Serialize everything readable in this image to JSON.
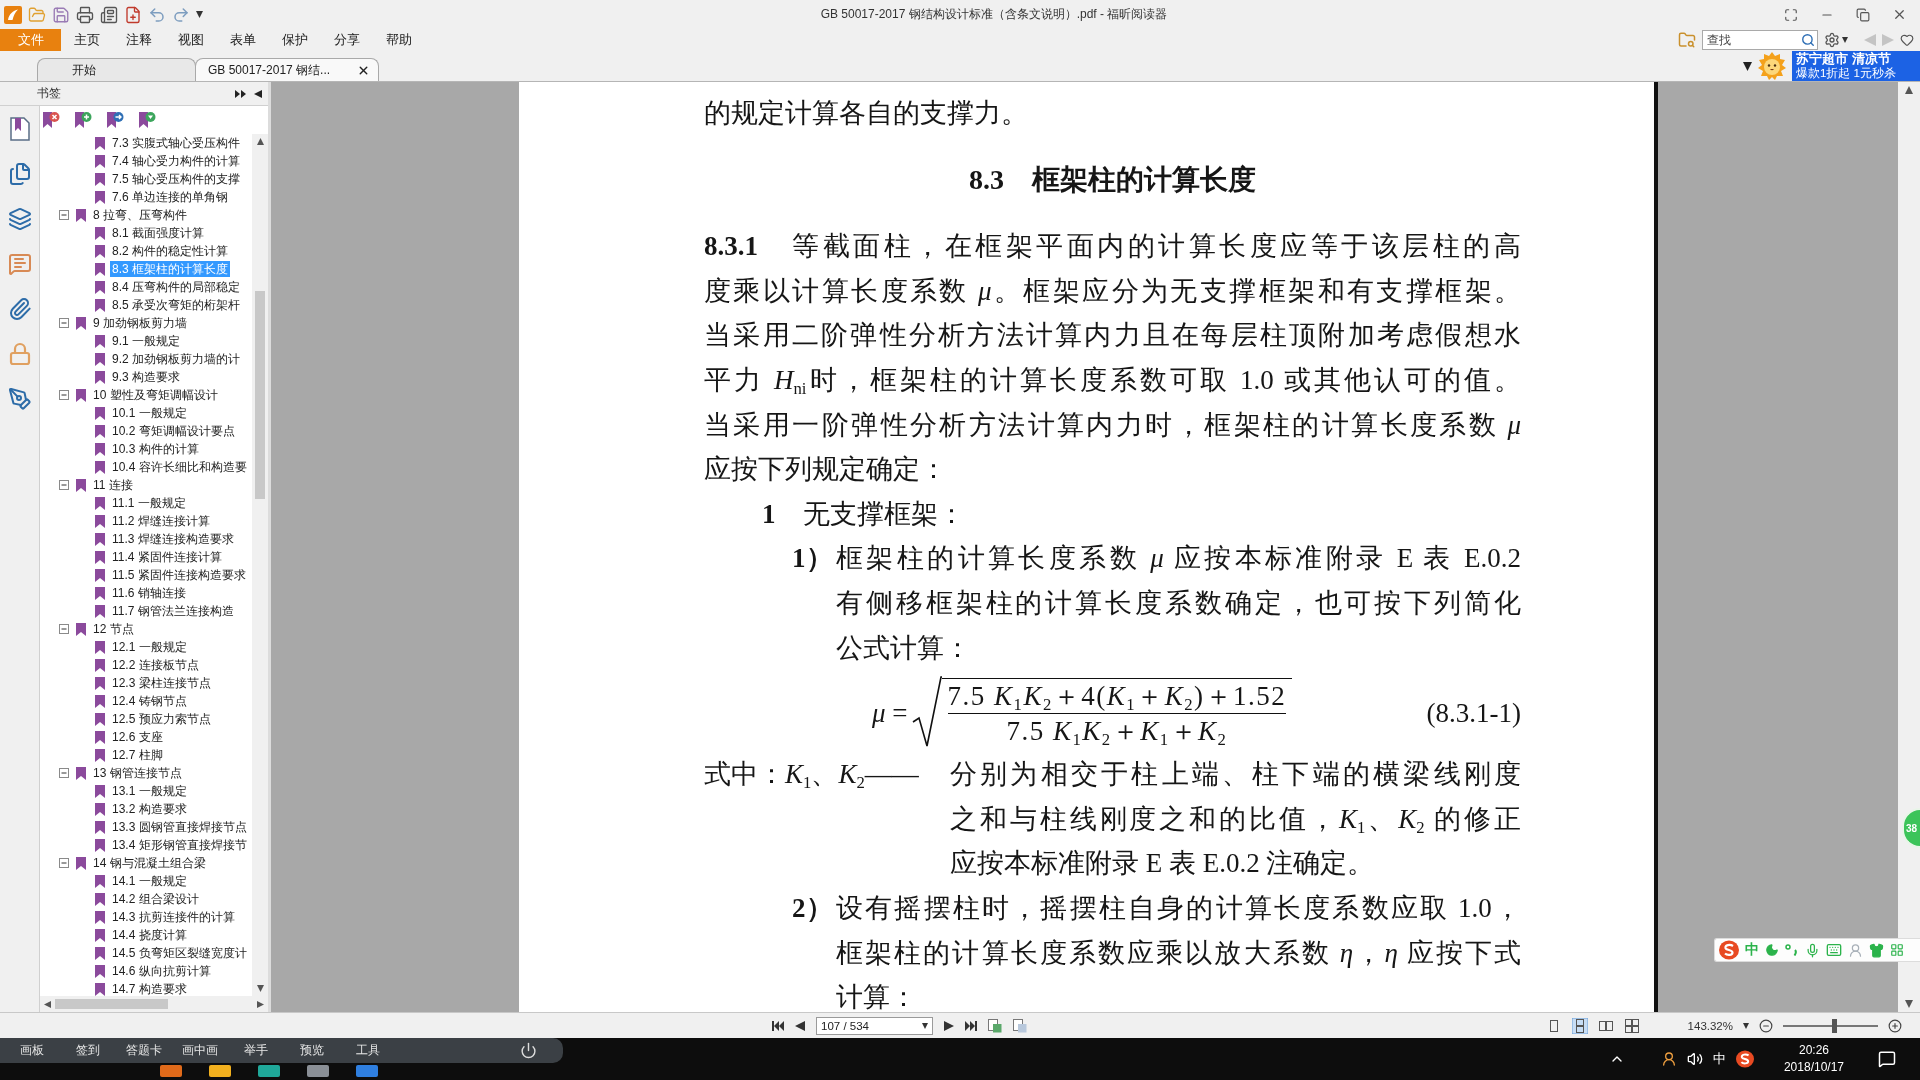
{
  "window": {
    "title": "GB 50017-2017 钢结构设计标准（含条文说明）.pdf - 福昕阅读器"
  },
  "menu": [
    {
      "label": "文件",
      "selected": true
    },
    {
      "label": "主页",
      "selected": false
    },
    {
      "label": "注释",
      "selected": false
    },
    {
      "label": "视图",
      "selected": false
    },
    {
      "label": "表单",
      "selected": false
    },
    {
      "label": "保护",
      "selected": false
    },
    {
      "label": "分享",
      "selected": false
    },
    {
      "label": "帮助",
      "selected": false
    }
  ],
  "search": {
    "placeholder": "查找"
  },
  "tabs": [
    {
      "label": "开始",
      "selected": false
    },
    {
      "label": "GB 50017-2017 钢结...",
      "selected": true
    }
  ],
  "ad_banner": {
    "headline": "苏宁超市 清凉节",
    "subline": "爆款1折起 1元秒杀"
  },
  "bookmarks_panel": {
    "title": "书签",
    "tree": [
      {
        "children": [
          {
            "label": "7.3 实腹式轴心受压构件",
            "selected": false
          },
          {
            "label": "7.4 轴心受力构件的计算",
            "selected": false
          },
          {
            "label": "7.5 轴心受压构件的支撑",
            "selected": false
          },
          {
            "label": "7.6 单边连接的单角钢",
            "selected": false
          }
        ]
      },
      {
        "label": "8 拉弯、压弯构件",
        "expanded": true,
        "selected": false,
        "children": [
          {
            "label": "8.1 截面强度计算",
            "selected": false
          },
          {
            "label": "8.2 构件的稳定性计算",
            "selected": false
          },
          {
            "label": "8.3 框架柱的计算长度",
            "selected": true
          },
          {
            "label": "8.4 压弯构件的局部稳定",
            "selected": false
          },
          {
            "label": "8.5 承受次弯矩的桁架杆",
            "selected": false
          }
        ]
      },
      {
        "label": "9 加劲钢板剪力墙",
        "expanded": true,
        "selected": false,
        "children": [
          {
            "label": "9.1 一般规定",
            "selected": false
          },
          {
            "label": "9.2 加劲钢板剪力墙的计",
            "selected": false
          },
          {
            "label": "9.3 构造要求",
            "selected": false
          }
        ]
      },
      {
        "label": "10 塑性及弯矩调幅设计",
        "expanded": true,
        "selected": false,
        "children": [
          {
            "label": "10.1 一般规定",
            "selected": false
          },
          {
            "label": "10.2 弯矩调幅设计要点",
            "selected": false
          },
          {
            "label": "10.3 构件的计算",
            "selected": false
          },
          {
            "label": "10.4 容许长细比和构造要",
            "selected": false
          }
        ]
      },
      {
        "label": "11 连接",
        "expanded": true,
        "selected": false,
        "children": [
          {
            "label": "11.1 一般规定",
            "selected": false
          },
          {
            "label": "11.2 焊缝连接计算",
            "selected": false
          },
          {
            "label": "11.3 焊缝连接构造要求",
            "selected": false
          },
          {
            "label": "11.4 紧固件连接计算",
            "selected": false
          },
          {
            "label": "11.5 紧固件连接构造要求",
            "selected": false
          },
          {
            "label": "11.6 销轴连接",
            "selected": false
          },
          {
            "label": "11.7 钢管法兰连接构造",
            "selected": false
          }
        ]
      },
      {
        "label": "12 节点",
        "expanded": true,
        "selected": false,
        "children": [
          {
            "label": "12.1 一般规定",
            "selected": false
          },
          {
            "label": "12.2 连接板节点",
            "selected": false
          },
          {
            "label": "12.3 梁柱连接节点",
            "selected": false
          },
          {
            "label": "12.4 铸钢节点",
            "selected": false
          },
          {
            "label": "12.5 预应力索节点",
            "selected": false
          },
          {
            "label": "12.6 支座",
            "selected": false
          },
          {
            "label": "12.7 柱脚",
            "selected": false
          }
        ]
      },
      {
        "label": "13 钢管连接节点",
        "expanded": true,
        "selected": false,
        "children": [
          {
            "label": "13.1 一般规定",
            "selected": false
          },
          {
            "label": "13.2 构造要求",
            "selected": false
          },
          {
            "label": "13.3 圆钢管直接焊接节点",
            "selected": false
          },
          {
            "label": "13.4 矩形钢管直接焊接节",
            "selected": false
          }
        ]
      },
      {
        "label": "14 钢与混凝土组合梁",
        "expanded": true,
        "selected": false,
        "children": [
          {
            "label": "14.1 一般规定",
            "selected": false
          },
          {
            "label": "14.2 组合梁设计",
            "selected": false
          },
          {
            "label": "14.3 抗剪连接件的计算",
            "selected": false
          },
          {
            "label": "14.4 挠度计算",
            "selected": false
          },
          {
            "label": "14.5 负弯矩区裂缝宽度计",
            "selected": false
          },
          {
            "label": "14.6 纵向抗剪计算",
            "selected": false
          },
          {
            "label": "14.7 构造要求",
            "selected": false
          }
        ]
      }
    ]
  },
  "document": {
    "blocks": [
      {
        "kind": "continuation",
        "lines": [
          "的规定计算各自的支撑力。"
        ]
      },
      {
        "kind": "heading",
        "text": "8.3　框架柱的计算长度"
      },
      {
        "kind": "clause",
        "lines": [
          "**8.3.1**　等截面柱，在框架平面内的计算长度应等于该层柱的高",
          "度乘以计算长度系数 *μ*。框架应分为无支撑框架和有支撑框架。",
          "当采用二阶弹性分析方法计算内力且在每层柱顶附加考虑假想水",
          "平力 *H*$_{ni}$时，框架柱的计算长度系数可取 1.0 或其他认可的值。",
          "当采用一阶弹性分析方法计算内力时，框架柱的计算长度系数 *μ*",
          "应按下列规定确定："
        ]
      },
      {
        "kind": "item",
        "lines": [
          "**1**　无支撑框架："
        ]
      },
      {
        "kind": "subitem",
        "marker": "1）",
        "lines": [
          "框架柱的计算长度系数 *μ* 应按本标准附录 E 表 E.0.2",
          "有侧移框架柱的计算长度系数确定，也可按下列简化",
          "公式计算："
        ]
      },
      {
        "kind": "formula",
        "lhs": "*μ* =",
        "numerator": "7.5 *K*$_{1}$*K*$_{2}$＋4(*K*$_{1}$＋*K*$_{2}$)＋1.52",
        "denominator": "7.5 *K*$_{1}$*K*$_{2}$＋*K*$_{1}$＋*K*$_{2}$",
        "number": "(8.3.1-1)"
      },
      {
        "kind": "definition",
        "term": "式中：*K*$_{1}$、*K*$_{2}$——",
        "lines": [
          "分别为相交于柱上端、柱下端的横梁线刚度",
          "之和与柱线刚度之和的比值，*K*$_{1}$、*K*$_{2}$ 的修正",
          "应按本标准附录 E 表 E.0.2 注确定。"
        ]
      },
      {
        "kind": "subitem",
        "marker": "2）",
        "lines": [
          "设有摇摆柱时，摇摆柱自身的计算长度系数应取 1.0，",
          "框架柱的计算长度系数应乘以放大系数 *η*，*η* 应按下式",
          "计算："
        ]
      }
    ]
  },
  "status_bar": {
    "page": "107 / 534",
    "view_modes": [
      {
        "kind": "single",
        "selected": false
      },
      {
        "kind": "continuous",
        "selected": true
      },
      {
        "kind": "facing",
        "selected": false
      },
      {
        "kind": "continuous_facing",
        "selected": false
      }
    ],
    "zoom": "143.32%",
    "zoom_slider": {
      "level": 0.54
    }
  },
  "ime_toolbar": {
    "mode": "中"
  },
  "floating_ball": {
    "count": "38"
  },
  "recorder_toolbar": {
    "items": [
      "画板",
      "签到",
      "答题卡",
      "画中画",
      "举手",
      "预览",
      "工具"
    ]
  },
  "taskbar": {
    "ime_indicator": "中",
    "time": "20:26",
    "date": "2018/10/17"
  }
}
